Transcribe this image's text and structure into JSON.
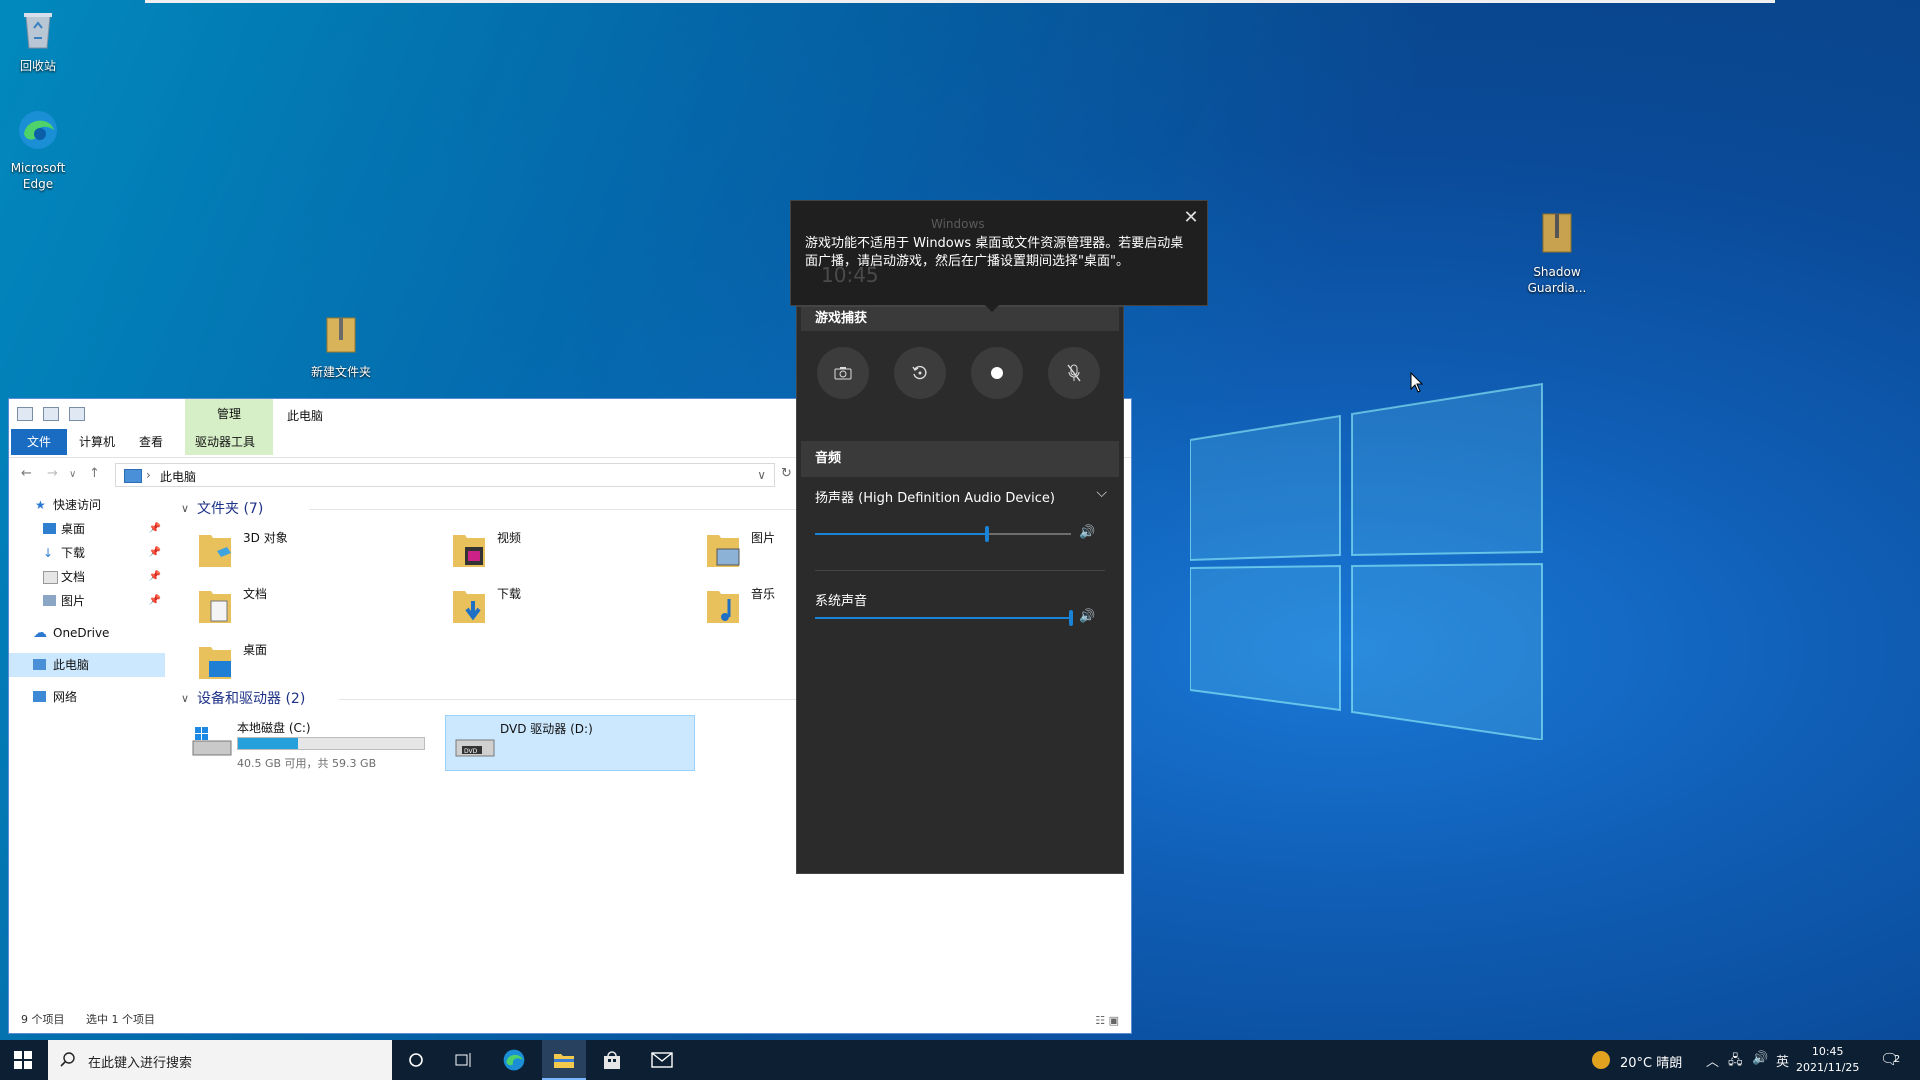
{
  "desktop": {
    "icons": [
      {
        "label": "回收站"
      },
      {
        "label": "Microsoft Edge"
      },
      {
        "label": "新建文件夹"
      },
      {
        "label": "Shadow Guardia..."
      }
    ]
  },
  "explorer": {
    "title": "此电脑",
    "context_tab": "管理",
    "ribbon_tabs": [
      "文件",
      "计算机",
      "查看",
      "驱动器工具"
    ],
    "address": "此电脑",
    "sidebar": [
      {
        "label": "快速访问",
        "pinned": false
      },
      {
        "label": "桌面",
        "pinned": true
      },
      {
        "label": "下载",
        "pinned": true
      },
      {
        "label": "文档",
        "pinned": true
      },
      {
        "label": "图片",
        "pinned": true
      },
      {
        "label": "OneDrive",
        "pinned": false
      },
      {
        "label": "此电脑",
        "pinned": false,
        "selected": true
      },
      {
        "label": "网络",
        "pinned": false
      }
    ],
    "folders_header": "文件夹 (7)",
    "folders": [
      "3D 对象",
      "视频",
      "图片",
      "文档",
      "下载",
      "音乐",
      "桌面"
    ],
    "devices_header": "设备和驱动器 (2)",
    "drives": [
      {
        "name": "本地磁盘 (C:)",
        "detail": "40.5 GB 可用，共 59.3 GB",
        "used_fraction": 0.32
      },
      {
        "name": "DVD 驱动器 (D:)",
        "selected": true
      }
    ],
    "status": {
      "items": "9 个项目",
      "selected": "选中 1 个项目"
    }
  },
  "gamebar": {
    "tooltip": {
      "ghost_title": "Windows",
      "ghost_time": "10:45",
      "message": "游戏功能不适用于 Windows 桌面或文件资源管理器。若要启动桌面广播，请启动游戏，然后在广播设置期间选择\"桌面\"。"
    },
    "capture_header": "游戏捕获",
    "capture_buttons": [
      "camera-icon",
      "replay-icon",
      "record-icon",
      "mic-off-icon"
    ],
    "audio_header": "音频",
    "device": "扬声器 (High Definition Audio Device)",
    "device_volume": 0.67,
    "system_label": "系统声音",
    "system_volume": 1.0
  },
  "taskbar": {
    "search_placeholder": "在此键入进行搜索",
    "weather": "20°C 晴朗",
    "ime": "英",
    "time": "10:45",
    "date": "2021/11/25",
    "notifications": "2"
  }
}
